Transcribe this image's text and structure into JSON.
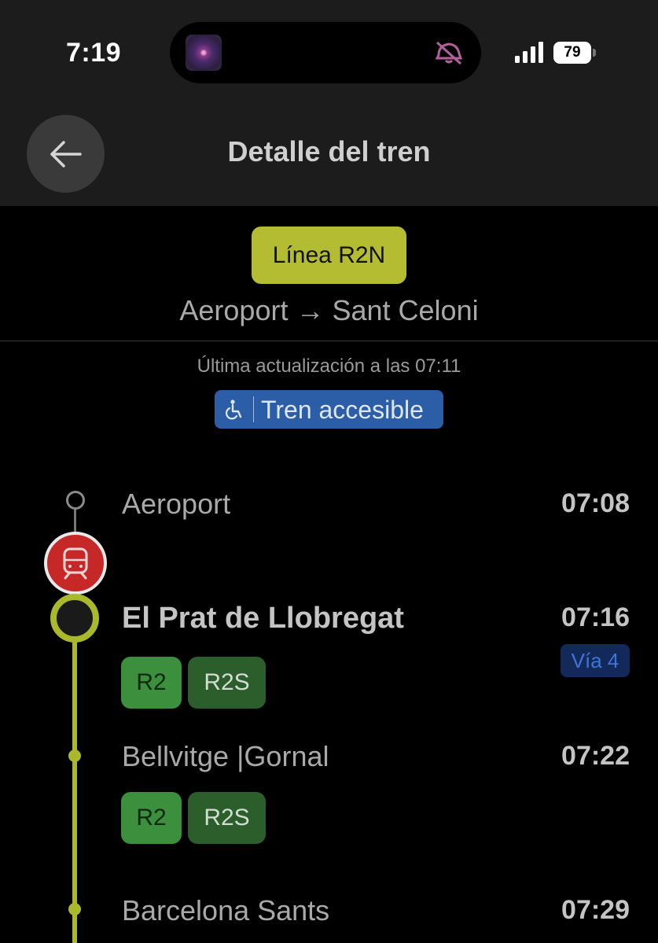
{
  "status_bar": {
    "time": "7:19",
    "battery": "79"
  },
  "header": {
    "title": "Detalle del tren"
  },
  "line": {
    "badge": "Línea R2N",
    "route": "Aeroport → Sant Celoni",
    "color": "#b4bd32"
  },
  "info": {
    "updated": "Última actualización a las 07:11",
    "accessible_label": "Tren accesible"
  },
  "stops": [
    {
      "name": "Aeroport",
      "time": "07:08"
    },
    {
      "name": "El Prat de Llobregat",
      "time": "07:16",
      "platform": "Vía 4",
      "connections": [
        "R2",
        "R2S"
      ]
    },
    {
      "name": "Bellvitge |Gornal",
      "time": "07:22",
      "connections": [
        "R2",
        "R2S"
      ]
    },
    {
      "name": "Barcelona Sants",
      "time": "07:29"
    }
  ],
  "icons": {
    "back": "arrow-left-icon",
    "train": "train-icon",
    "accessible": "wheelchair-icon",
    "silent": "bell-slash-icon"
  }
}
